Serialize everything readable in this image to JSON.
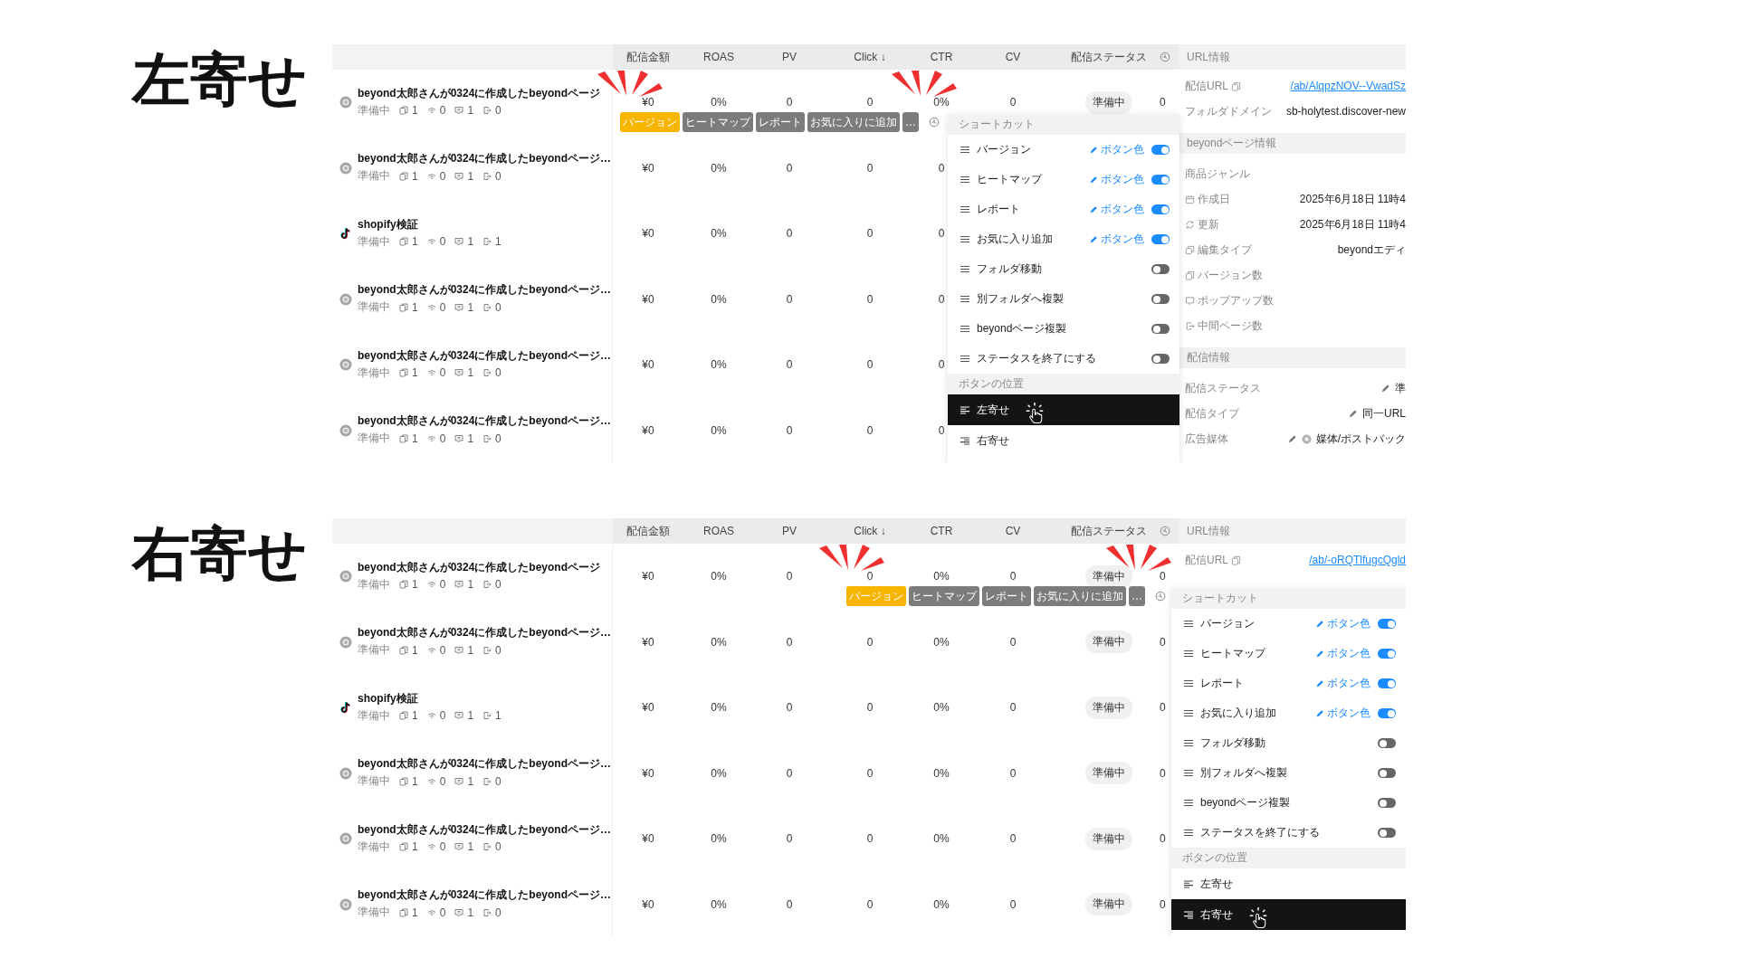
{
  "sections": [
    {
      "heading": "左寄せ",
      "columns": [
        "配信金額",
        "ROAS",
        "PV",
        "Click ↓",
        "CTR",
        "CV",
        "配信ステータス"
      ],
      "rows": [
        {
          "kind": "page",
          "title": "beyond太郎さんが0324に作成したbeyondページ",
          "status": "準備中",
          "counts": [
            "1",
            "0",
            "1",
            "0"
          ],
          "cells": [
            "¥0",
            "0%",
            "0",
            "0",
            "0%",
            "0"
          ],
          "delivery_status": "準備中",
          "column_9": "0"
        },
        {
          "kind": "page",
          "title": "beyond太郎さんが0324に作成したbeyondページ…",
          "status": "準備中",
          "counts": [
            "1",
            "0",
            "1",
            "0"
          ],
          "cells": [
            "¥0",
            "0%",
            "0",
            "0",
            "0"
          ]
        },
        {
          "kind": "tiktok",
          "title": "shopify検証",
          "status": "準備中",
          "counts": [
            "1",
            "0",
            "1",
            "1"
          ],
          "cells": [
            "¥0",
            "0%",
            "0",
            "0",
            "0"
          ]
        },
        {
          "kind": "page",
          "title": "beyond太郎さんが0324に作成したbeyondページ…",
          "status": "準備中",
          "counts": [
            "1",
            "0",
            "1",
            "0"
          ],
          "cells": [
            "¥0",
            "0%",
            "0",
            "0",
            "0"
          ]
        },
        {
          "kind": "page",
          "title": "beyond太郎さんが0324に作成したbeyondページ…",
          "status": "準備中",
          "counts": [
            "1",
            "0",
            "1",
            "0"
          ],
          "cells": [
            "¥0",
            "0%",
            "0",
            "0",
            "0"
          ]
        },
        {
          "kind": "page",
          "title": "beyond太郎さんが0324に作成したbeyondページ…",
          "status": "準備中",
          "counts": [
            "1",
            "0",
            "1",
            "0"
          ],
          "cells": [
            "¥0",
            "0%",
            "0",
            "0",
            "0"
          ]
        }
      ],
      "toolbar": [
        {
          "label": "バージョン",
          "kind": "primary"
        },
        {
          "label": "ヒートマップ",
          "kind": "secondary"
        },
        {
          "label": "レポート",
          "kind": "secondary"
        },
        {
          "label": "お気に入りに追加",
          "kind": "secondary"
        },
        {
          "label": "…",
          "kind": "secondary"
        }
      ],
      "menu": {
        "shortcut_title": "ショートカット",
        "items": [
          {
            "label": "バージョン",
            "color_label": "ボタン色",
            "on": true
          },
          {
            "label": "ヒートマップ",
            "color_label": "ボタン色",
            "on": true
          },
          {
            "label": "レポート",
            "color_label": "ボタン色",
            "on": true
          },
          {
            "label": "お気に入り追加",
            "color_label": "ボタン色",
            "on": true
          },
          {
            "label": "フォルダ移動",
            "on": false
          },
          {
            "label": "別フォルダへ複製",
            "on": false
          },
          {
            "label": "beyondページ複製",
            "on": false
          },
          {
            "label": "ステータスを終了にする",
            "on": false
          }
        ],
        "position_title": "ボタンの位置",
        "positions": [
          {
            "label": "左寄せ",
            "kind": "left",
            "selected": true
          },
          {
            "label": "右寄せ",
            "kind": "right",
            "selected": false
          }
        ]
      },
      "info": [
        {
          "title": "URL情報",
          "rows": [
            {
              "label": "配信URL",
              "copyable": true,
              "kind": "link",
              "value": "/ab/AlqpzNOV--VwadSz"
            },
            {
              "label": "フォルダドメイン",
              "value": "sb-holytest.discover-new"
            }
          ]
        },
        {
          "title": "beyondページ情報",
          "rows": [
            {
              "label": "商品ジャンル"
            },
            {
              "label": "作成日",
              "kind": "calendar",
              "value": "2025年6月18日 11時4"
            },
            {
              "label": "更新",
              "kind": "refresh",
              "value": "2025年6月18日 11時4"
            },
            {
              "label": "編集タイプ",
              "kind": "layers",
              "value": "beyondエディ"
            },
            {
              "label": "バージョン数",
              "kind": "copy"
            },
            {
              "label": "ポップアップ数",
              "kind": "popup"
            },
            {
              "label": "中間ページ数",
              "kind": "exit"
            }
          ]
        },
        {
          "title": "配信情報",
          "rows": [
            {
              "label": "配信ステータス",
              "editable": true,
              "value": "準"
            },
            {
              "label": "配信タイプ",
              "editable": true,
              "value": "同一URL"
            },
            {
              "label": "広告媒体",
              "editable": true,
              "media": true,
              "value": "媒体/ポストバック"
            }
          ]
        }
      ]
    },
    {
      "heading": "右寄せ",
      "columns": [
        "配信金額",
        "ROAS",
        "PV",
        "Click ↓",
        "CTR",
        "CV",
        "配信ステータス"
      ],
      "rows": [
        {
          "kind": "page",
          "title": "beyond太郎さんが0324に作成したbeyondページ",
          "status": "準備中",
          "counts": [
            "1",
            "0",
            "1",
            "0"
          ],
          "cells": [
            "¥0",
            "0%",
            "0",
            "0",
            "0%",
            "0"
          ],
          "delivery_status": "準備中",
          "column_9": "0"
        },
        {
          "kind": "page",
          "title": "beyond太郎さんが0324に作成したbeyondページ…",
          "status": "準備中",
          "counts": [
            "1",
            "0",
            "1",
            "0"
          ],
          "cells": [
            "¥0",
            "0%",
            "0",
            "0",
            "0%",
            "0"
          ],
          "delivery_status": "準備中",
          "column_9": "0"
        },
        {
          "kind": "tiktok",
          "title": "shopify検証",
          "status": "準備中",
          "counts": [
            "1",
            "0",
            "1",
            "1"
          ],
          "cells": [
            "¥0",
            "0%",
            "0",
            "0",
            "0%",
            "0"
          ],
          "delivery_status": "準備中",
          "column_9": "0"
        },
        {
          "kind": "page",
          "title": "beyond太郎さんが0324に作成したbeyondページ…",
          "status": "準備中",
          "counts": [
            "1",
            "0",
            "1",
            "0"
          ],
          "cells": [
            "¥0",
            "0%",
            "0",
            "0",
            "0%",
            "0"
          ],
          "delivery_status": "準備中",
          "column_9": "0"
        },
        {
          "kind": "page",
          "title": "beyond太郎さんが0324に作成したbeyondページ…",
          "status": "準備中",
          "counts": [
            "1",
            "0",
            "1",
            "0"
          ],
          "cells": [
            "¥0",
            "0%",
            "0",
            "0",
            "0%",
            "0"
          ],
          "delivery_status": "準備中",
          "column_9": "0"
        },
        {
          "kind": "page",
          "title": "beyond太郎さんが0324に作成したbeyondページ…",
          "status": "準備中",
          "counts": [
            "1",
            "0",
            "1",
            "0"
          ],
          "cells": [
            "¥0",
            "0%",
            "0",
            "0",
            "0%",
            "0"
          ],
          "delivery_status": "準備中",
          "column_9": "0"
        }
      ],
      "toolbar": [
        {
          "label": "バージョン",
          "kind": "primary"
        },
        {
          "label": "ヒートマップ",
          "kind": "secondary"
        },
        {
          "label": "レポート",
          "kind": "secondary"
        },
        {
          "label": "お気に入りに追加",
          "kind": "secondary"
        },
        {
          "label": "…",
          "kind": "secondary"
        }
      ],
      "menu": {
        "shortcut_title": "ショートカット",
        "items": [
          {
            "label": "バージョン",
            "color_label": "ボタン色",
            "on": true
          },
          {
            "label": "ヒートマップ",
            "color_label": "ボタン色",
            "on": true
          },
          {
            "label": "レポート",
            "color_label": "ボタン色",
            "on": true
          },
          {
            "label": "お気に入り追加",
            "color_label": "ボタン色",
            "on": true
          },
          {
            "label": "フォルダ移動",
            "on": false
          },
          {
            "label": "別フォルダへ複製",
            "on": false
          },
          {
            "label": "beyondページ複製",
            "on": false
          },
          {
            "label": "ステータスを終了にする",
            "on": false
          }
        ],
        "position_title": "ボタンの位置",
        "positions": [
          {
            "label": "左寄せ",
            "kind": "left",
            "selected": false
          },
          {
            "label": "右寄せ",
            "kind": "right",
            "selected": true
          }
        ]
      },
      "info": [
        {
          "title": "URL情報",
          "rows": [
            {
              "label": "配信URL",
              "copyable": true,
              "kind": "link",
              "value": "/ab/-oRQTlfugcQgld"
            }
          ]
        }
      ]
    }
  ]
}
